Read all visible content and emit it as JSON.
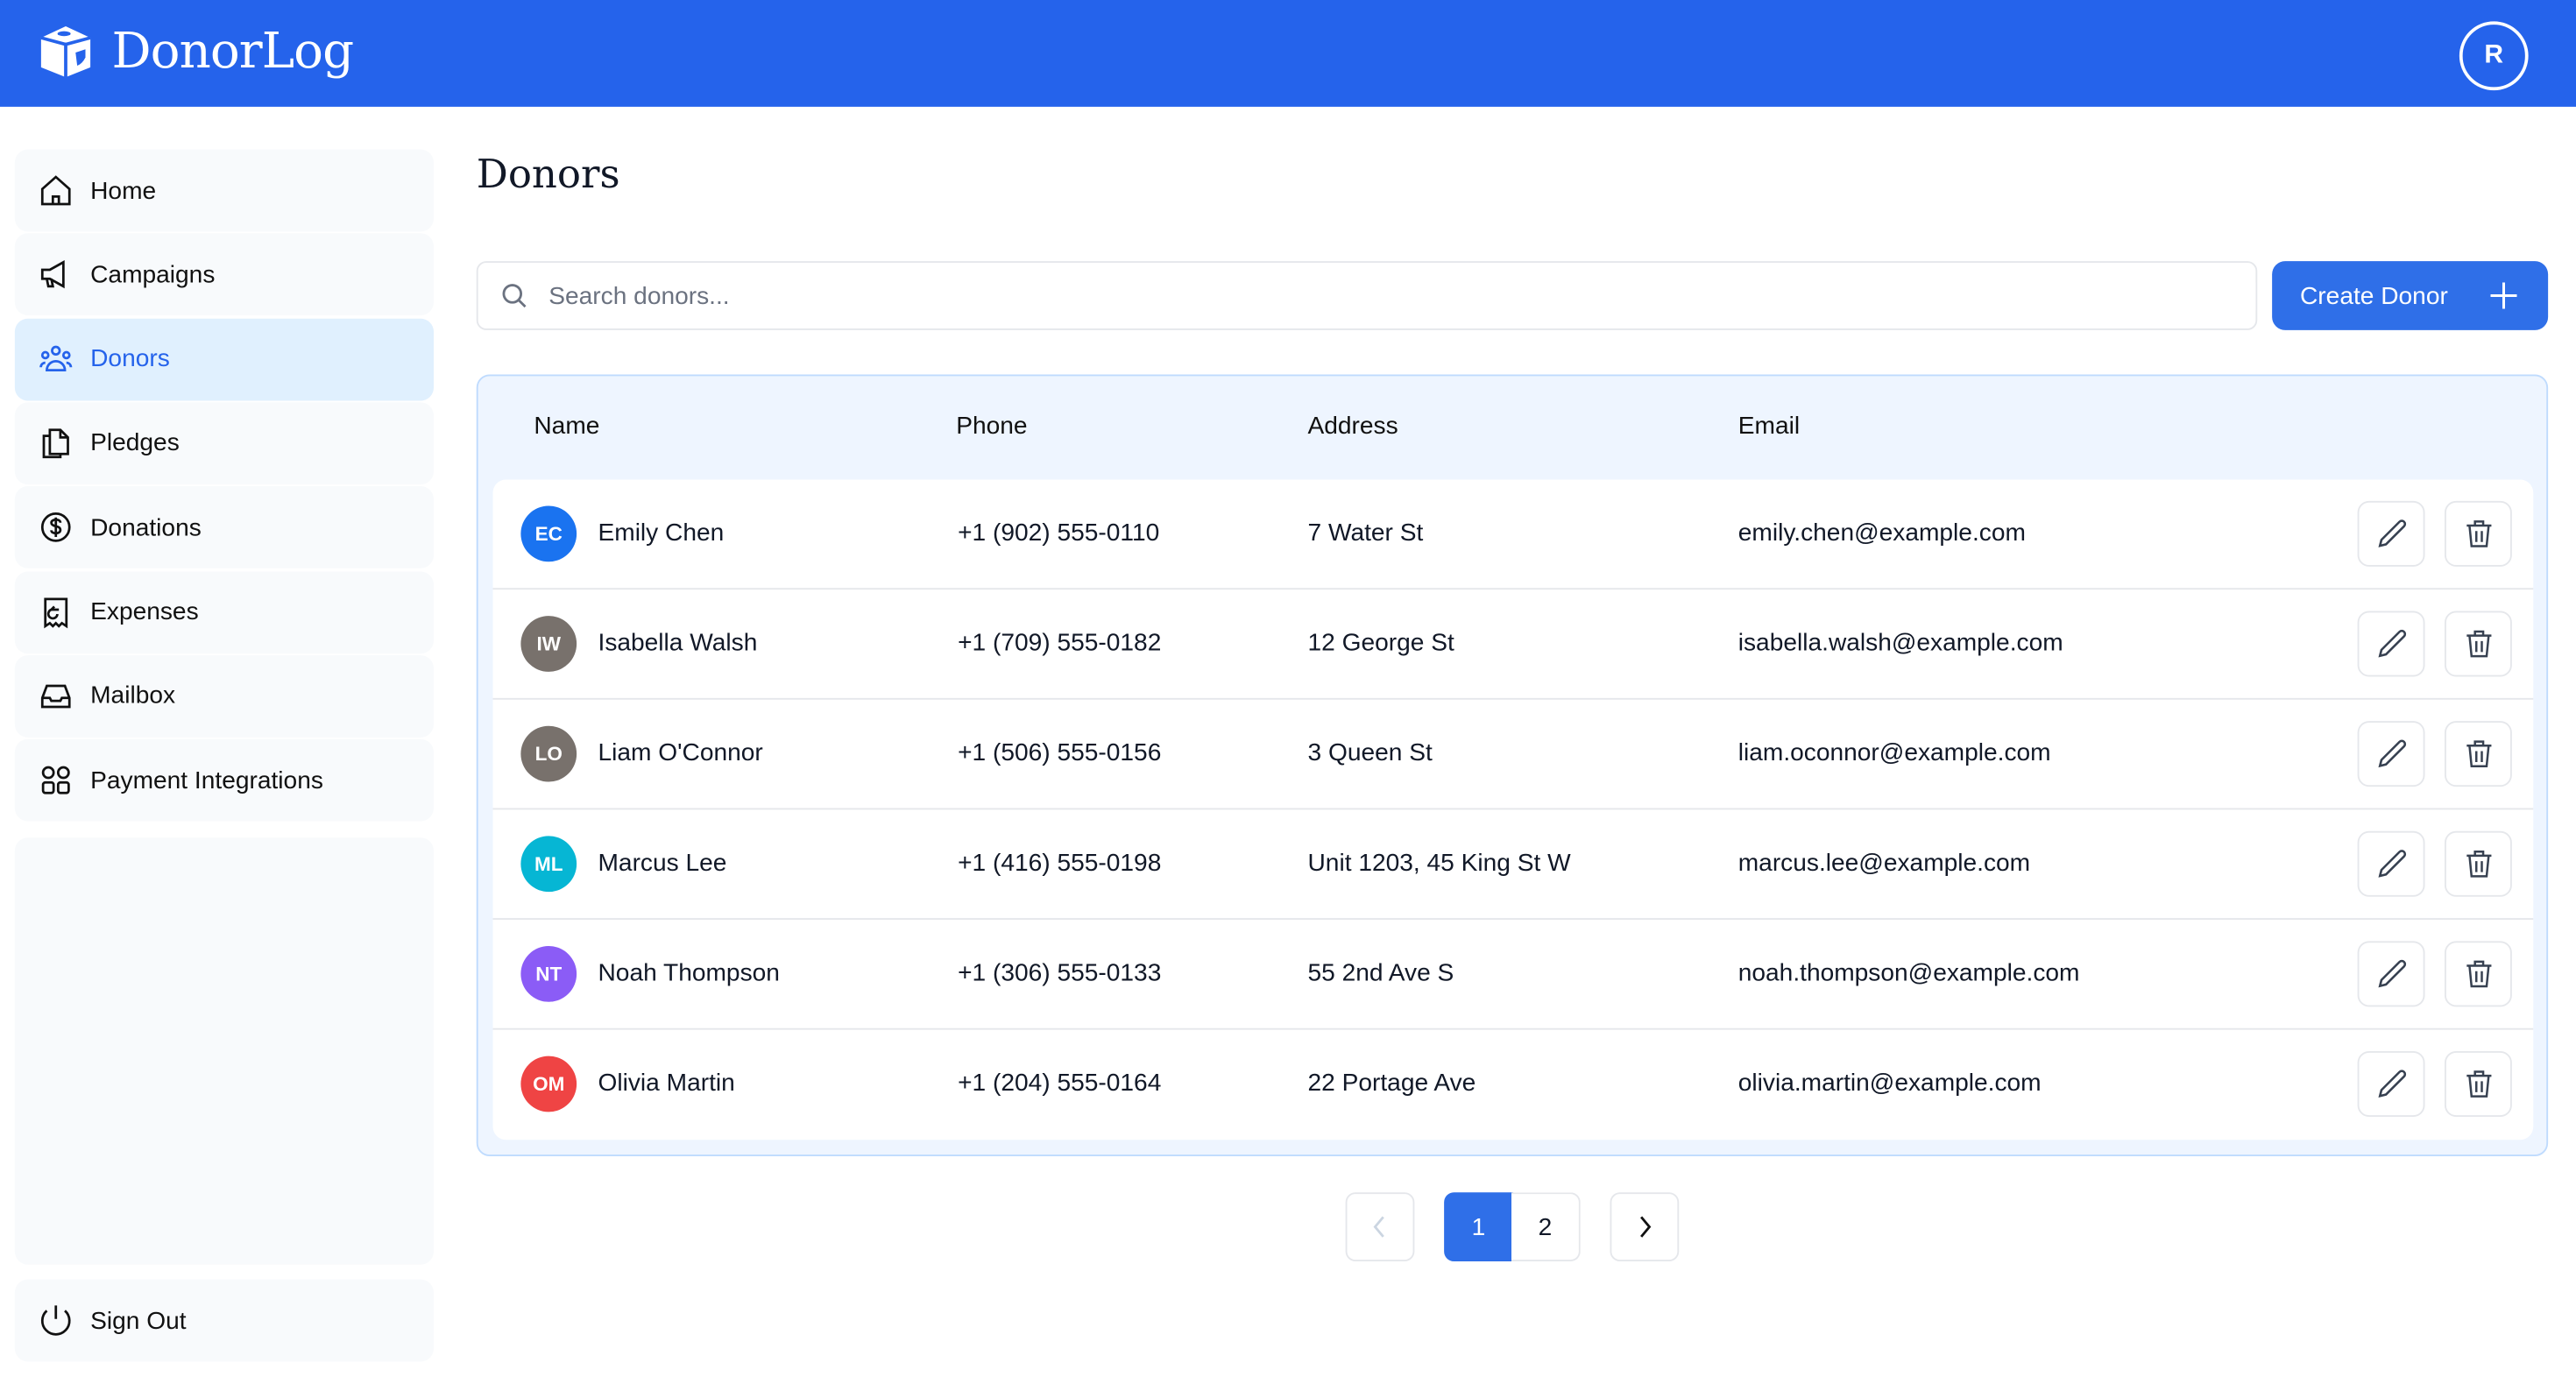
{
  "app": {
    "title": "DonorLog",
    "user_initial": "R"
  },
  "sidebar": {
    "items": [
      {
        "label": "Home",
        "icon": "home-icon"
      },
      {
        "label": "Campaigns",
        "icon": "megaphone-icon"
      },
      {
        "label": "Donors",
        "icon": "users-icon",
        "active": true
      },
      {
        "label": "Pledges",
        "icon": "documents-icon"
      },
      {
        "label": "Donations",
        "icon": "dollar-icon"
      },
      {
        "label": "Expenses",
        "icon": "receipt-icon"
      },
      {
        "label": "Mailbox",
        "icon": "inbox-icon"
      },
      {
        "label": "Payment Integrations",
        "icon": "grid-icon"
      }
    ],
    "sign_out": "Sign Out"
  },
  "main": {
    "title": "Donors",
    "search_placeholder": "Search donors...",
    "create_label": "Create Donor"
  },
  "table": {
    "columns": [
      "Name",
      "Phone",
      "Address",
      "Email"
    ],
    "rows": [
      {
        "initials": "EC",
        "name": "Emily Chen",
        "phone": "+1 (902) 555-0110",
        "address": "7 Water St",
        "email": "emily.chen@example.com",
        "color": "#1a73f0"
      },
      {
        "initials": "IW",
        "name": "Isabella Walsh",
        "phone": "+1 (709) 555-0182",
        "address": "12 George St",
        "email": "isabella.walsh@example.com",
        "color": "#78716c"
      },
      {
        "initials": "LO",
        "name": "Liam O'Connor",
        "phone": "+1 (506) 555-0156",
        "address": "3 Queen St",
        "email": "liam.oconnor@example.com",
        "color": "#78716c"
      },
      {
        "initials": "ML",
        "name": "Marcus Lee",
        "phone": "+1 (416) 555-0198",
        "address": "Unit 1203, 45 King St W",
        "email": "marcus.lee@example.com",
        "color": "#06b6d4"
      },
      {
        "initials": "NT",
        "name": "Noah Thompson",
        "phone": "+1 (306) 555-0133",
        "address": "55 2nd Ave S",
        "email": "noah.thompson@example.com",
        "color": "#8b5cf6"
      },
      {
        "initials": "OM",
        "name": "Olivia Martin",
        "phone": "+1 (204) 555-0164",
        "address": "22 Portage Ave",
        "email": "olivia.martin@example.com",
        "color": "#ef4444"
      }
    ]
  },
  "pagination": {
    "pages": [
      "1",
      "2"
    ],
    "current": "1"
  }
}
